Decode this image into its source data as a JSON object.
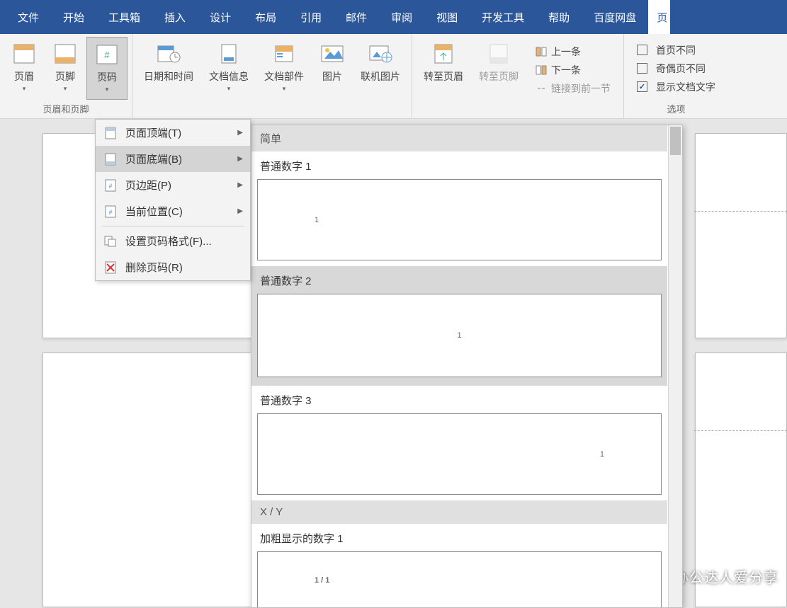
{
  "tabs": [
    "文件",
    "开始",
    "工具箱",
    "插入",
    "设计",
    "布局",
    "引用",
    "邮件",
    "审阅",
    "视图",
    "开发工具",
    "帮助",
    "百度网盘",
    "页"
  ],
  "ribbon": {
    "group1_label": "页眉和页脚",
    "header_btn": "页眉",
    "footer_btn": "页脚",
    "pagenum_btn": "页码",
    "datetime_btn": "日期和时间",
    "docinfo_btn": "文档信息",
    "docparts_btn": "文档部件",
    "picture_btn": "图片",
    "onlinepic_btn": "联机图片",
    "goto_header": "转至页眉",
    "goto_footer": "转至页脚",
    "prev": "上一条",
    "next": "下一条",
    "link_prev": "链接到前一节",
    "first_diff": "首页不同",
    "oddeven_diff": "奇偶页不同",
    "show_doc_text": "显示文档文字",
    "options_label": "选项"
  },
  "menu": {
    "top_of_page": "页面顶端(T)",
    "bottom_of_page": "页面底端(B)",
    "page_margins": "页边距(P)",
    "current_position": "当前位置(C)",
    "format_page_numbers": "设置页码格式(F)...",
    "remove_page_numbers": "删除页码(R)"
  },
  "gallery": {
    "section_simple": "简单",
    "item1": "普通数字 1",
    "item2": "普通数字 2",
    "item3": "普通数字 3",
    "section_xy": "X / Y",
    "item4": "加粗显示的数字 1",
    "sample_num": "1",
    "sample_xy": "1 / 1"
  },
  "watermark": "头条 @办公达人爱分享"
}
